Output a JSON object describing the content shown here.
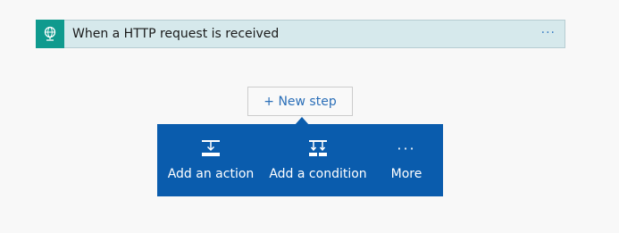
{
  "trigger": {
    "title": "When a HTTP request is received",
    "icon": "http-globe-icon",
    "menu_label": "···"
  },
  "new_step": {
    "label": "+ New step"
  },
  "menu": {
    "items": [
      {
        "label": "Add an action",
        "icon": "add-action-icon"
      },
      {
        "label": "Add a condition",
        "icon": "add-condition-icon"
      },
      {
        "label": "More",
        "icon": "more-icon",
        "glyph": "···"
      }
    ]
  },
  "colors": {
    "trigger_bg": "#d6e9ec",
    "trigger_icon_bg": "#0f9a8e",
    "accent_blue": "#0a5cad",
    "link_blue": "#2b6fb8"
  }
}
